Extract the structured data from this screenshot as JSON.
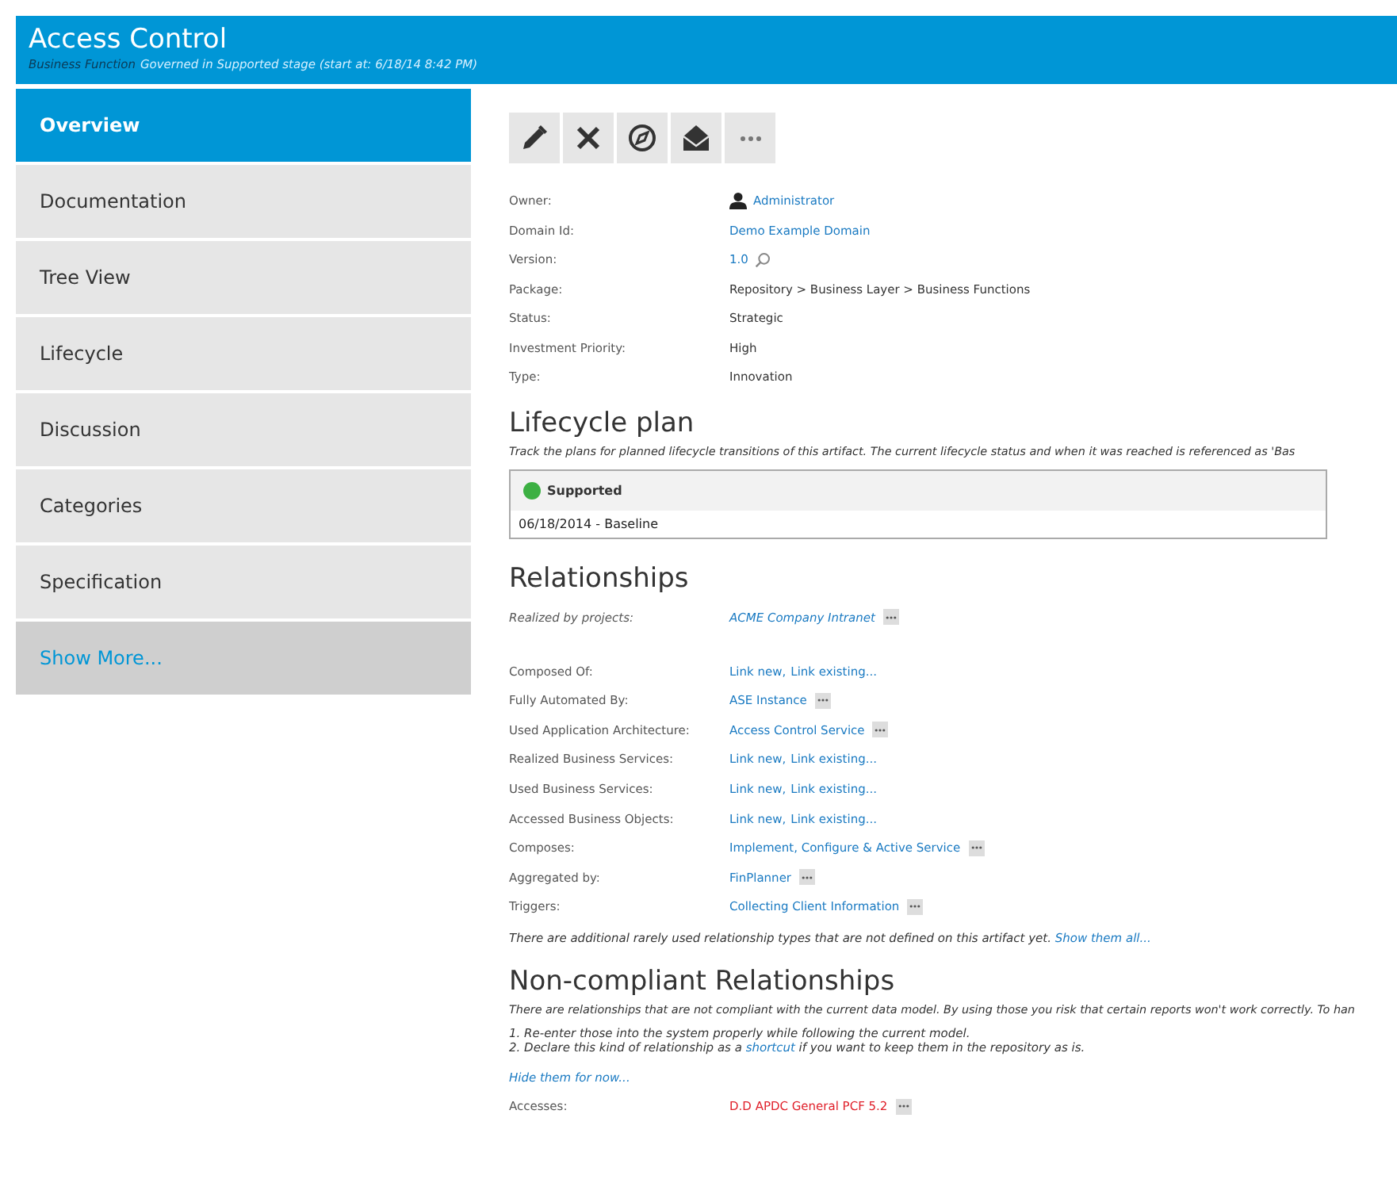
{
  "header": {
    "title": "Access Control",
    "type": "Business Function",
    "subtitle": "Governed in Supported stage (start at: 6/18/14 8:42 PM)"
  },
  "sidebar": {
    "items": [
      {
        "label": "Overview",
        "selected": true,
        "kind": "tab"
      },
      {
        "label": "Documentation",
        "selected": false,
        "kind": "tab"
      },
      {
        "label": "Tree View",
        "selected": false,
        "kind": "tab"
      },
      {
        "label": "Lifecycle",
        "selected": false,
        "kind": "tab"
      },
      {
        "label": "Discussion",
        "selected": false,
        "kind": "tab"
      },
      {
        "label": "Categories",
        "selected": false,
        "kind": "tab"
      },
      {
        "label": "Specification",
        "selected": false,
        "kind": "tab"
      },
      {
        "label": "Show More...",
        "selected": false,
        "kind": "more"
      }
    ]
  },
  "properties": [
    {
      "label": "Owner:",
      "value": "Administrator",
      "kind": "user"
    },
    {
      "label": "Domain Id:",
      "value": "Demo Example Domain",
      "kind": "link"
    },
    {
      "label": "Version:",
      "value": "1.0",
      "kind": "version"
    },
    {
      "label": "Package:",
      "value": "Repository > Business Layer > Business Functions",
      "kind": "text"
    },
    {
      "label": "Status:",
      "value": "Strategic",
      "kind": "text"
    },
    {
      "label": "Investment Priority:",
      "value": "High",
      "kind": "text"
    },
    {
      "label": "Type:",
      "value": "Innovation",
      "kind": "text"
    }
  ],
  "lifecycle": {
    "title": "Lifecycle plan",
    "description": "Track the plans for planned lifecycle transitions of this artifact. The current lifecycle status and when it was reached is referenced as 'Bas",
    "stage": "Supported",
    "color": "#3cb043",
    "entry": "06/18/2014 - Baseline"
  },
  "relationships": {
    "title": "Relationships",
    "rows": [
      {
        "label": "Realized by projects:",
        "kind": "project",
        "links": [
          "ACME Company Intranet"
        ],
        "more": true
      },
      {
        "label": "Composed Of:",
        "kind": "normal",
        "links": [
          "Link new,",
          "Link existing..."
        ],
        "more": false
      },
      {
        "label": "Fully Automated By:",
        "kind": "normal",
        "links": [
          "ASE Instance"
        ],
        "more": true
      },
      {
        "label": "Used Application Architecture:",
        "kind": "normal",
        "links": [
          "Access Control Service"
        ],
        "more": true
      },
      {
        "label": "Realized Business Services:",
        "kind": "normal",
        "links": [
          "Link new,",
          "Link existing..."
        ],
        "more": false
      },
      {
        "label": "Used Business Services:",
        "kind": "normal",
        "links": [
          "Link new,",
          "Link existing..."
        ],
        "more": false
      },
      {
        "label": "Accessed Business Objects:",
        "kind": "normal",
        "links": [
          "Link new,",
          "Link existing..."
        ],
        "more": false
      },
      {
        "label": "Composes:",
        "kind": "normal",
        "links": [
          "Implement, Configure & Active Service"
        ],
        "more": true
      },
      {
        "label": "Aggregated by:",
        "kind": "normal",
        "links": [
          "FinPlanner"
        ],
        "more": true
      },
      {
        "label": "Triggers:",
        "kind": "normal",
        "links": [
          "Collecting Client Information"
        ],
        "more": true
      }
    ],
    "note": "There are additional rarely used relationship types that are not defined on this artifact yet.",
    "note_link": "Show them all..."
  },
  "noncompliant": {
    "title": "Non-compliant Relationships",
    "description": "There are relationships that are not compliant with the current data model. By using those you risk that certain reports won't work correctly. To han",
    "steps": [
      {
        "text": "1. Re-enter those into the system properly while following the current model."
      },
      {
        "before": "2. Declare this kind of relationship as a",
        "link": "shortcut",
        "after": "if you want to keep them in the repository as is."
      }
    ],
    "hide_link": "Hide them for now...",
    "rows": [
      {
        "label": "Accesses:",
        "kind": "invalid",
        "links": [
          "D.D APDC General PCF 5.2"
        ],
        "more": true
      }
    ]
  }
}
